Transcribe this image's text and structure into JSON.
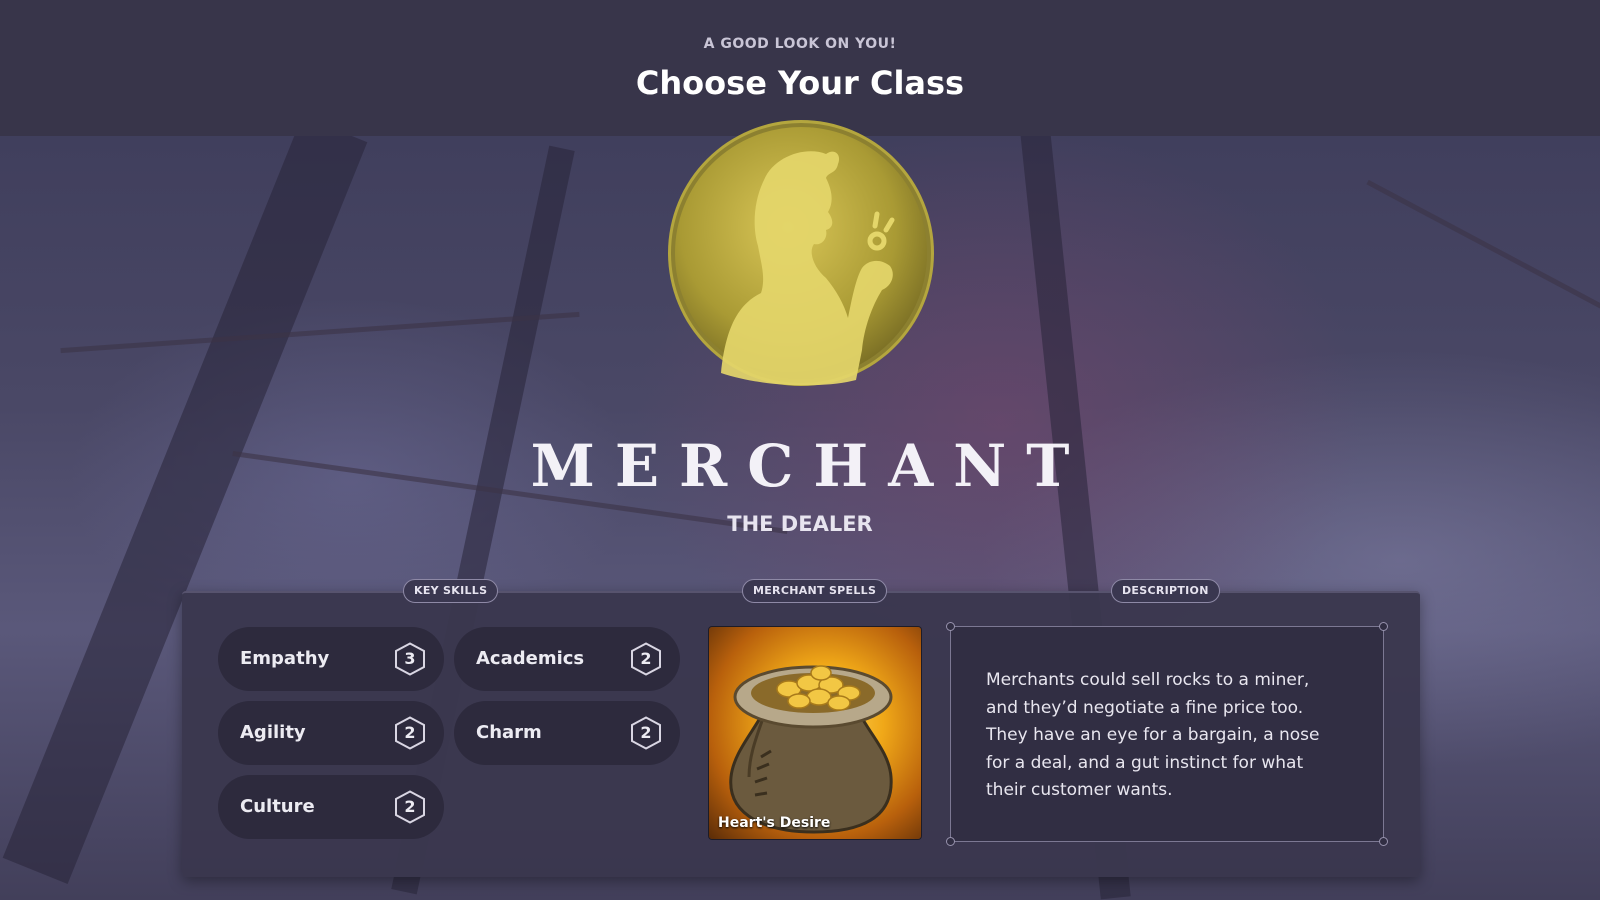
{
  "header": {
    "eyebrow": "A GOOD LOOK ON YOU!",
    "title": "Choose Your Class"
  },
  "class_info": {
    "name": "MERCHANT",
    "subtitle": "THE DEALER",
    "portrait_icon": "merchant-portrait-icon"
  },
  "sections": {
    "key_skills": "KEY SKILLS",
    "spells": "MERCHANT SPELLS",
    "description": "DESCRIPTION"
  },
  "skills": [
    {
      "label": "Empathy",
      "value": "3"
    },
    {
      "label": "Academics",
      "value": "2"
    },
    {
      "label": "Agility",
      "value": "2"
    },
    {
      "label": "Charm",
      "value": "2"
    },
    {
      "label": "Culture",
      "value": "2"
    }
  ],
  "spell": {
    "name": "Heart's Desire",
    "icon": "coin-bag-icon"
  },
  "description": "Merchants could sell rocks to a miner, and they’d negotiate a fine price too. They have an eye for a bargain, a nose for a deal, and a gut instinct for what their customer wants.",
  "colors": {
    "gold": "#c9b44a",
    "panel": "#3a374e",
    "header": "#38354a"
  }
}
